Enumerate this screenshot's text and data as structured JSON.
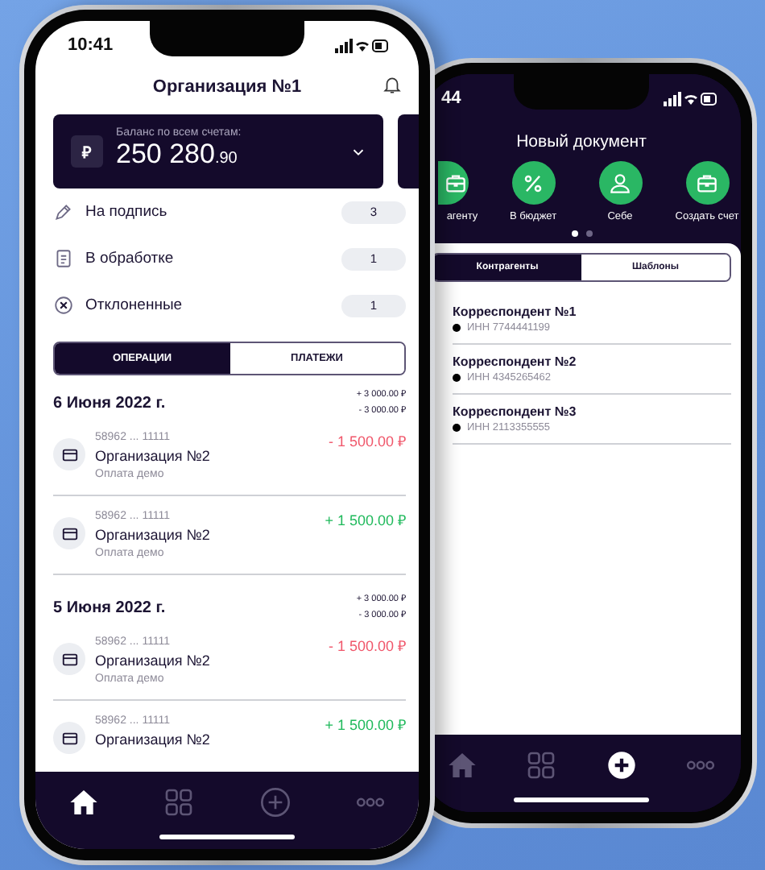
{
  "main_phone": {
    "status_time": "10:41",
    "title": "Организация №1",
    "balance": {
      "currency": "₽",
      "label": "Баланс по всем счетам:",
      "whole": "250 280",
      "fraction": ".90"
    },
    "status_rows": [
      {
        "kind": "sign",
        "label": "На подпись",
        "count": "3"
      },
      {
        "kind": "processing",
        "label": "В обработке",
        "count": "1"
      },
      {
        "kind": "rejected",
        "label": "Отклоненные",
        "count": "1"
      }
    ],
    "tabs": [
      {
        "label": "ОПЕРАЦИИ",
        "selected": true
      },
      {
        "label": "ПЛАТЕЖИ",
        "selected": false
      }
    ],
    "days": [
      {
        "date": "6 Июня 2022 г.",
        "income": "+ 3 000.00 ₽",
        "expense": "- 3 000.00 ₽",
        "operations": [
          {
            "account": "58962 ... 11111",
            "name": "Организация №2",
            "purpose": "Оплата демо",
            "amount": "- 1 500.00 ₽",
            "color": "#f0566a"
          },
          {
            "account": "58962 ... 11111",
            "name": "Организация №2",
            "purpose": "Оплата демо",
            "amount": "+ 1 500.00 ₽",
            "color": "#1fb95b"
          }
        ]
      },
      {
        "date": "5 Июня 2022 г.",
        "income": "+ 3 000.00 ₽",
        "expense": "- 3 000.00 ₽",
        "operations": [
          {
            "account": "58962 ... 11111",
            "name": "Организация №2",
            "purpose": "Оплата демо",
            "amount": "- 1 500.00 ₽",
            "color": "#f0566a"
          },
          {
            "account": "58962 ... 11111",
            "name": "Организация №2",
            "amount": "+ 1 500.00 ₽",
            "color": "#1fb95b"
          }
        ]
      }
    ],
    "nav": [
      {
        "kind": "home",
        "selected": true
      },
      {
        "kind": "grid",
        "selected": false
      },
      {
        "kind": "plus",
        "selected": false
      },
      {
        "kind": "more",
        "selected": false
      }
    ]
  },
  "second_phone": {
    "status_time": "44",
    "title": "Новый документ",
    "actions": [
      {
        "kind": "briefcase",
        "label": "агенту"
      },
      {
        "kind": "percent",
        "label": "В бюджет"
      },
      {
        "kind": "person",
        "label": "Себе"
      },
      {
        "kind": "briefcase",
        "label": "Создать счет"
      }
    ],
    "pager": [
      {
        "selected": true
      },
      {
        "selected": false
      }
    ],
    "tabs": [
      {
        "label": "Контрагенты",
        "selected": true
      },
      {
        "label": "Шаблоны",
        "selected": false
      }
    ],
    "contacts": [
      {
        "name": "Корреспондент №1",
        "inn": "ИНН 7744441199"
      },
      {
        "name": "Корреспондент №2",
        "inn": "ИНН 4345265462"
      },
      {
        "name": "Корреспондент №3",
        "inn": "ИНН 2113355555"
      }
    ],
    "nav": [
      {
        "kind": "home",
        "selected": false
      },
      {
        "kind": "grid",
        "selected": false
      },
      {
        "kind": "plus",
        "selected": true
      },
      {
        "kind": "more",
        "selected": false
      }
    ]
  }
}
